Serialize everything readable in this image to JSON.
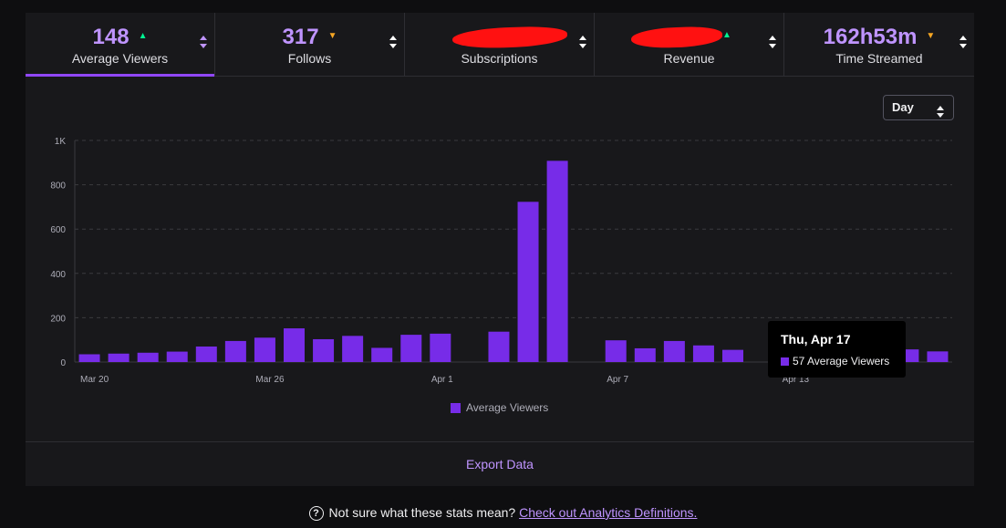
{
  "tabs": [
    {
      "value": "148",
      "label": "Average Viewers",
      "trend": "up",
      "active": true
    },
    {
      "value": "317",
      "label": "Follows",
      "trend": "down",
      "active": false
    },
    {
      "value": "",
      "label": "Subscriptions",
      "trend": "",
      "active": false,
      "redacted": true
    },
    {
      "value": "",
      "label": "Revenue",
      "trend": "up",
      "active": false,
      "redacted": true
    },
    {
      "value": "162h53m",
      "label": "Time Streamed",
      "trend": "down",
      "active": false
    }
  ],
  "icons": {
    "sort": "sort-updown-icon",
    "trend_up": "caret-up-icon",
    "trend_down": "caret-down-icon",
    "help": "question-circle-icon"
  },
  "range_select": {
    "value": "Day"
  },
  "tooltip": {
    "title": "Thu, Apr 17",
    "value_text": "57 Average Viewers"
  },
  "footer": {
    "export_label": "Export Data"
  },
  "help": {
    "text": "Not sure what these stats mean?",
    "link": "Check out Analytics Definitions."
  },
  "colors": {
    "bar": "#772ce8",
    "accent": "#9147ff",
    "value_text": "#bf94ff",
    "up": "#00f593",
    "down": "#f5a623"
  },
  "chart_data": {
    "type": "bar",
    "series": [
      {
        "name": "Average Viewers",
        "values": [
          35,
          38,
          42,
          47,
          70,
          95,
          110,
          152,
          103,
          118,
          64,
          123,
          128,
          0,
          137,
          723,
          908,
          0,
          98,
          62,
          95,
          75,
          55,
          0,
          0,
          0,
          0,
          0,
          57,
          48
        ]
      }
    ],
    "categories": [
      "Mar 20",
      "Mar 21",
      "Mar 22",
      "Mar 23",
      "Mar 24",
      "Mar 25",
      "Mar 26",
      "Mar 27",
      "Mar 28",
      "Mar 29",
      "Mar 30",
      "Mar 31",
      "Apr 1",
      "Apr 2",
      "Apr 3",
      "Apr 4",
      "Apr 5",
      "Apr 6",
      "Apr 7",
      "Apr 8",
      "Apr 9",
      "Apr 10",
      "Apr 11",
      "Apr 12",
      "Apr 13",
      "Apr 14",
      "Apr 15",
      "Apr 16",
      "Apr 17",
      "Apr 18"
    ],
    "x_tick_labels": [
      "Mar 20",
      "Mar 26",
      "Apr 1",
      "Apr 7",
      "Apr 13"
    ],
    "y_ticks": [
      "0",
      "200",
      "400",
      "600",
      "800",
      "1K"
    ],
    "ylim": [
      0,
      1000
    ],
    "grid": true,
    "legend": "bottom"
  }
}
